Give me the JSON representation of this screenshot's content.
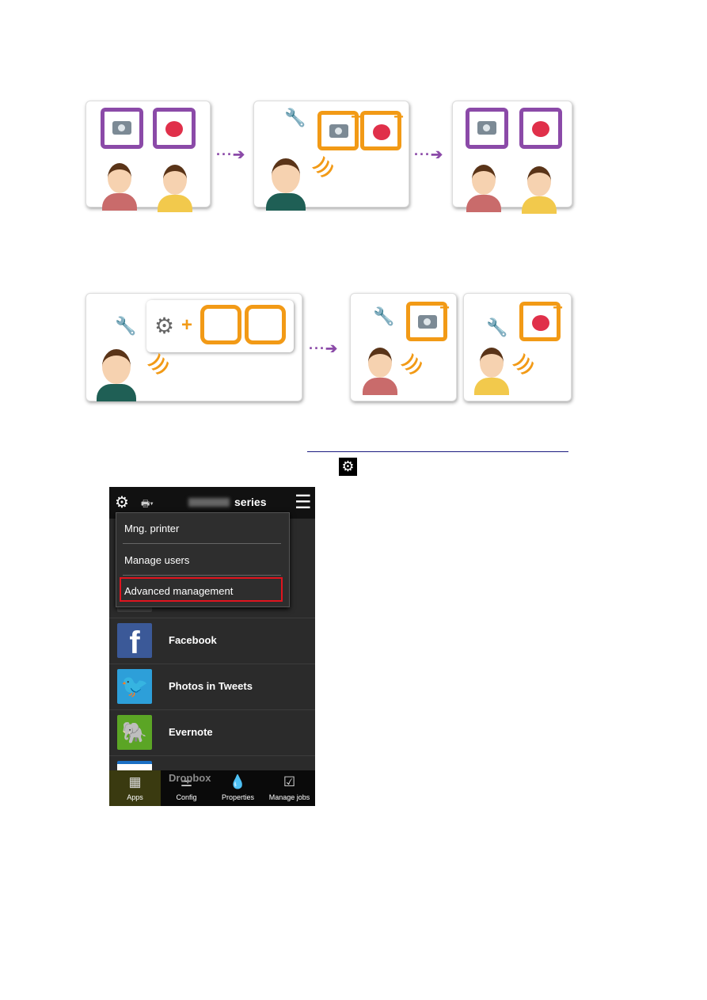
{
  "illustrations": {
    "row1": [
      "users-requesting-apps",
      "admin-adding-apps",
      "users-using-apps"
    ],
    "row2": [
      "admin-granting-rights",
      "user-adding-app",
      "user-adding-app"
    ]
  },
  "link": {
    "text": ""
  },
  "phone": {
    "header": {
      "model": "MG5700",
      "series": "series",
      "icons": [
        "gear-icon",
        "printer-icon",
        "menu-icon"
      ]
    },
    "menu": {
      "items": [
        "Mng. printer",
        "Manage users",
        "Advanced management"
      ],
      "highlighted": "Advanced management",
      "highlight_color": "#e0141e"
    },
    "apps": [
      "Facebook",
      "Photos in Tweets",
      "Evernote",
      "Dropbox"
    ],
    "tabs": [
      "Apps",
      "Config",
      "Properties",
      "Manage jobs"
    ],
    "active_tab": "Apps"
  },
  "colors": {
    "purple": "#8b4aa8",
    "orange": "#f29a16"
  }
}
